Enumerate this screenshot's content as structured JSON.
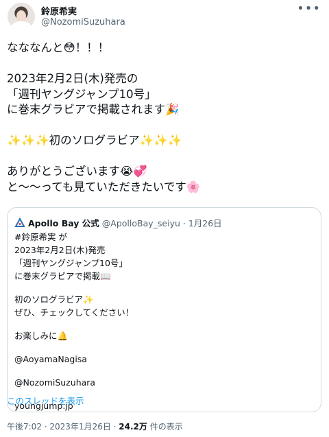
{
  "author": {
    "name": "鈴原希実",
    "handle": "@NozomiSuzuhara"
  },
  "more_label": "•••",
  "tweet": {
    "line1": "なななんと😳！！！",
    "line2": "2023年2月2日(木)発売の",
    "line3": "「週刊ヤングジャンプ10号」",
    "line4": "に巻末グラビアで掲載されます🎉",
    "line5": "✨✨✨初のソログラビア✨✨✨",
    "line6": "ありがとうございます😭💞",
    "line7": "と～～っても見ていただきたいです🌸"
  },
  "quote": {
    "account_name": "Apollo Bay 公式",
    "account_handle": "@ApolloBay_seiyu",
    "date": "· 1月26日",
    "body1": "#鈴原希実 が",
    "body2": "2023年2月2日(木)発売",
    "body3": "「週刊ヤングジャンプ10号」",
    "body4": "に巻末グラビアで掲載📖",
    "body5": "初のソログラビア✨",
    "body6": "ぜひ、チェックしてください！",
    "body7": "お楽しみに🔔",
    "body8": "@AoyamaNagisa",
    "body9": "@NozomiSuzuhara",
    "body10": "youngjump.jp",
    "thread_link": "このスレッドを表示"
  },
  "footer": {
    "time": "午後7:02 · 2023年1月26日 · ",
    "views": "24.2万",
    "views_suffix": " 件の表示"
  },
  "colors": {
    "link": "#1d9bf0",
    "secondary_text": "#536471",
    "border": "#cfd9de"
  }
}
